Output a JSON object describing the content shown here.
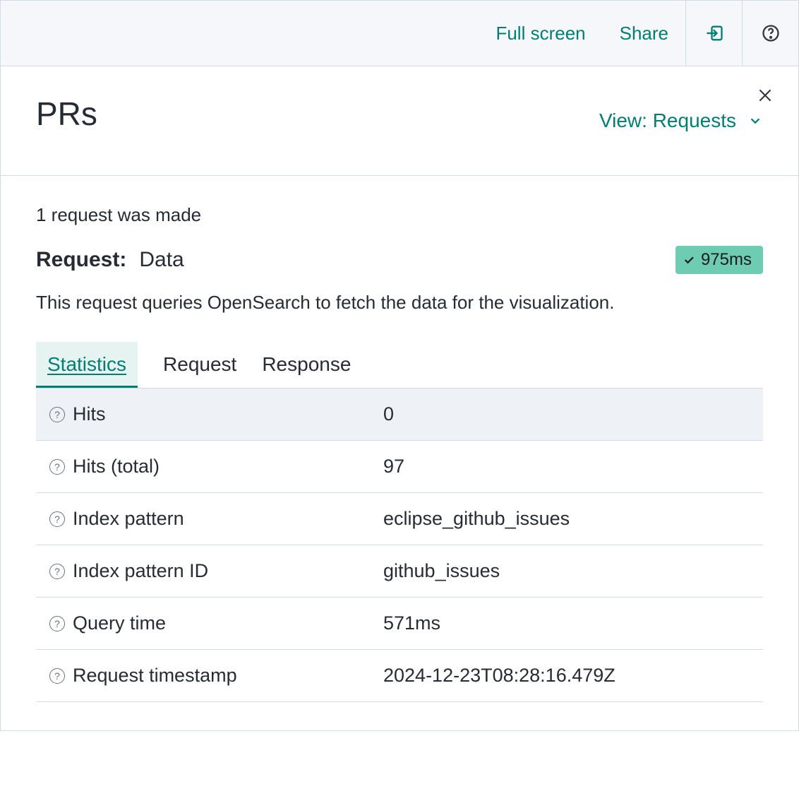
{
  "topbar": {
    "full_screen": "Full screen",
    "share": "Share"
  },
  "panel": {
    "title": "PRs",
    "view_label": "View: Requests"
  },
  "request": {
    "note": "1 request was made",
    "label": "Request:",
    "name": "Data",
    "badge_time": "975ms",
    "description": "This request queries OpenSearch to fetch the data for the visualization."
  },
  "tabs": {
    "statistics": "Statistics",
    "request": "Request",
    "response": "Response"
  },
  "stats": [
    {
      "key": "Hits",
      "val": "0"
    },
    {
      "key": "Hits (total)",
      "val": "97"
    },
    {
      "key": "Index pattern",
      "val": "eclipse_github_issues"
    },
    {
      "key": "Index pattern ID",
      "val": "github_issues"
    },
    {
      "key": "Query time",
      "val": "571ms"
    },
    {
      "key": "Request timestamp",
      "val": "2024-12-23T08:28:16.479Z"
    }
  ]
}
